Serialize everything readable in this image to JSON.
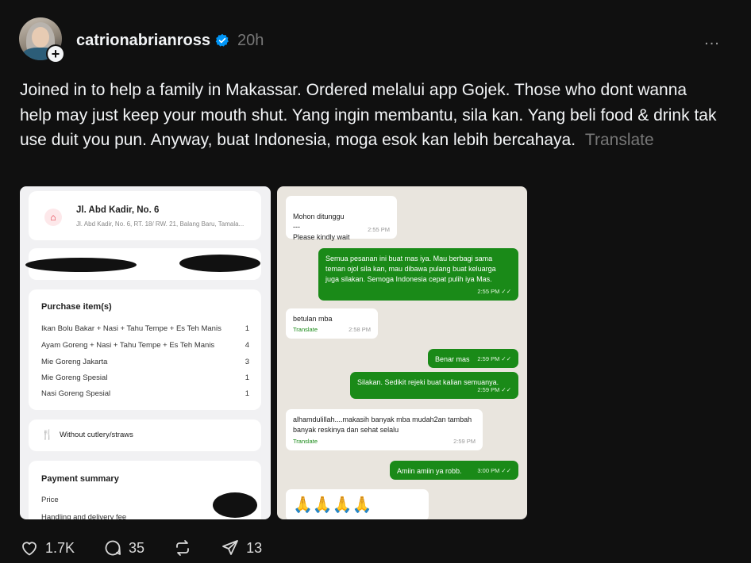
{
  "post": {
    "username": "catrionabrianross",
    "time": "20h",
    "caption": "Joined in to help a family in Makassar. Ordered melalui app Gojek. Those who dont wanna help may just keep your mouth shut. Yang ingin membantu, sila kan. Yang beli food & drink tak use duit you pun. Anyway, buat Indonesia, moga esok kan lebih bercahaya.",
    "translate_label": "Translate",
    "more_label": "..."
  },
  "receipt": {
    "address_title": "Jl. Abd Kadir, No. 6",
    "address_sub": "Jl. Abd Kadir, No. 6, RT. 18/ RW. 21, Balang Baru, Tamala...",
    "purchase_title": "Purchase item(s)",
    "items": [
      {
        "name": "Ikan Bolu Bakar + Nasi + Tahu Tempe + Es Teh Manis",
        "qty": "1"
      },
      {
        "name": "Ayam Goreng + Nasi + Tahu Tempe + Es Teh Manis",
        "qty": "4"
      },
      {
        "name": "Mie Goreng Jakarta",
        "qty": "3"
      },
      {
        "name": "Mie Goreng Spesial",
        "qty": "1"
      },
      {
        "name": "Nasi Goreng Spesial",
        "qty": "1"
      }
    ],
    "cutlery": "Without cutlery/straws",
    "payment_title": "Payment summary",
    "price_label": "Price",
    "handling_label": "Handling and delivery fee"
  },
  "chat": {
    "messages": [
      {
        "dir": "in",
        "text": "Mohon ditunggu\n---\nPlease kindly wait",
        "time": "2:55 PM",
        "translate": ""
      },
      {
        "dir": "out",
        "text": "Semua pesanan ini buat mas iya. Mau berbagi sama teman ojol sila kan, mau dibawa pulang buat keluarga juga silakan.  Semoga Indonesia cepat pulih iya Mas.",
        "time": "2:55 PM ✓✓",
        "translate": ""
      },
      {
        "dir": "in",
        "text": "betulan mba",
        "time": "2:58 PM",
        "translate": "Translate"
      },
      {
        "dir": "out",
        "text": "Benar mas",
        "time": "2:59 PM ✓✓",
        "translate": ""
      },
      {
        "dir": "out",
        "text": "Silakan. Sedikit rejeki buat kalian semuanya.",
        "time": "2:59 PM ✓✓",
        "translate": ""
      },
      {
        "dir": "in",
        "text": "alhamdulillah....makasih banyak mba mudah2an tambah banyak reskinya dan sehat selalu",
        "time": "2:59 PM",
        "translate": "Translate"
      },
      {
        "dir": "out",
        "text": "Amiin amiin ya robb.",
        "time": "3:00 PM ✓✓",
        "translate": ""
      },
      {
        "dir": "in",
        "text": "🙏🙏🙏🙏",
        "time": "",
        "translate": ""
      }
    ]
  },
  "actions": {
    "likes": "1.7K",
    "comments": "35",
    "shares": "13"
  },
  "colors": {
    "background": "#101010",
    "accent_verified": "#0095f6",
    "chat_outgoing": "#1a8a18"
  }
}
